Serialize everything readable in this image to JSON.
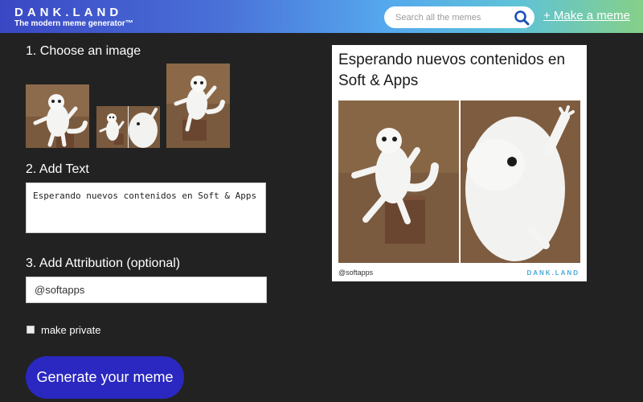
{
  "header": {
    "logo": "DANK.LAND",
    "tagline": "The modern meme generator™",
    "search_placeholder": "Search all the memes",
    "make_meme_link": "+ Make a meme"
  },
  "steps": {
    "choose_image": "1. Choose an image",
    "add_text": "2. Add Text",
    "add_attribution": "3. Add Attribution (optional)"
  },
  "thumbnails": [
    {
      "name": "single-cat-thumb"
    },
    {
      "name": "split-cat-thumb"
    },
    {
      "name": "cat-on-box-thumb"
    }
  ],
  "form": {
    "meme_text": "Esperando nuevos contenidos en Soft & Apps",
    "attribution": "@softapps",
    "make_private_label": "make private",
    "make_private_checked": false,
    "generate_button": "Generate your meme"
  },
  "preview": {
    "caption": "Esperando nuevos contenidos en Soft & Apps",
    "attribution": "@softapps",
    "brand": "DANK.LAND"
  },
  "colors": {
    "background": "#222222",
    "header_gradient_start": "#3a47c4",
    "header_gradient_end": "#86d089",
    "button": "#2a28c0",
    "search_icon": "#1a4fb8"
  }
}
